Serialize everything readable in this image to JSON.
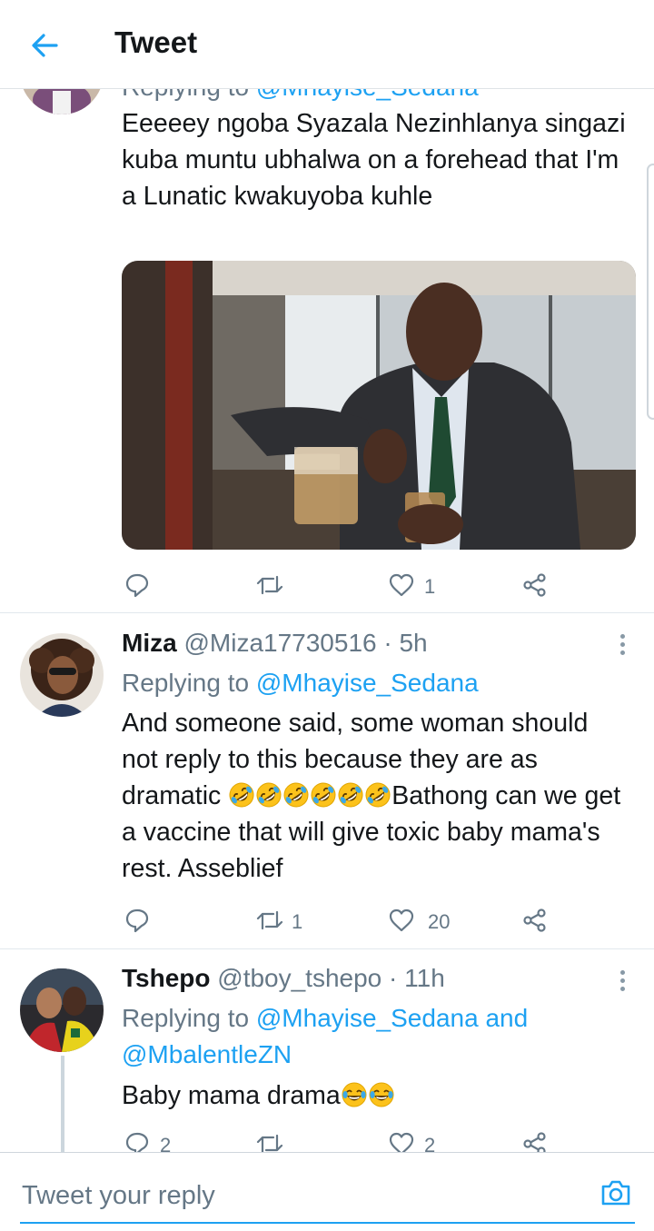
{
  "header": {
    "title": "Tweet"
  },
  "tweets": [
    {
      "replying_prefix": "Replying to",
      "reply_handle": "@Mhayise_Sedana",
      "text": "Eeeeey ngoba Syazala Nezinhlanya singazi kuba muntu ubhalwa on a forehead that I'm a Lunatic kwakuyoba kuhle",
      "reply_count": "",
      "retweet_count": "",
      "like_count": "1"
    },
    {
      "name": "Miza",
      "handle": "@Miza17730516",
      "time": "· 5h",
      "replying_prefix": "Replying to",
      "reply_handle": "@Mhayise_Sedana",
      "text_before": "And someone said, some woman should not reply to this because they are as dramatic ",
      "emoji_count": 6,
      "text_after": "Bathong can we get a vaccine that will give toxic baby mama's rest.  Asseblief",
      "reply_count": "",
      "retweet_count": "1",
      "like_count": "20"
    },
    {
      "name": "Tshepo",
      "handle": "@tboy_tshepo",
      "time": "· 11h",
      "replying_prefix": "Replying to",
      "reply_handle": "@Mhayise_Sedana",
      "reply_and": "and",
      "reply_handle_2": "@MbalentleZN",
      "text": "Baby mama drama",
      "emoji_count": 2,
      "reply_count": "2",
      "retweet_count": "",
      "like_count": "2"
    }
  ],
  "compose": {
    "placeholder": "Tweet your reply"
  },
  "icons": [
    "back-arrow-icon",
    "reply-icon",
    "retweet-icon",
    "like-icon",
    "share-icon",
    "more-icon",
    "camera-icon",
    "rofl-emoji",
    "joy-emoji"
  ],
  "colors": {
    "accent": "#1da1f2",
    "secondary_text": "#657786",
    "divider": "#e1e8ed"
  }
}
